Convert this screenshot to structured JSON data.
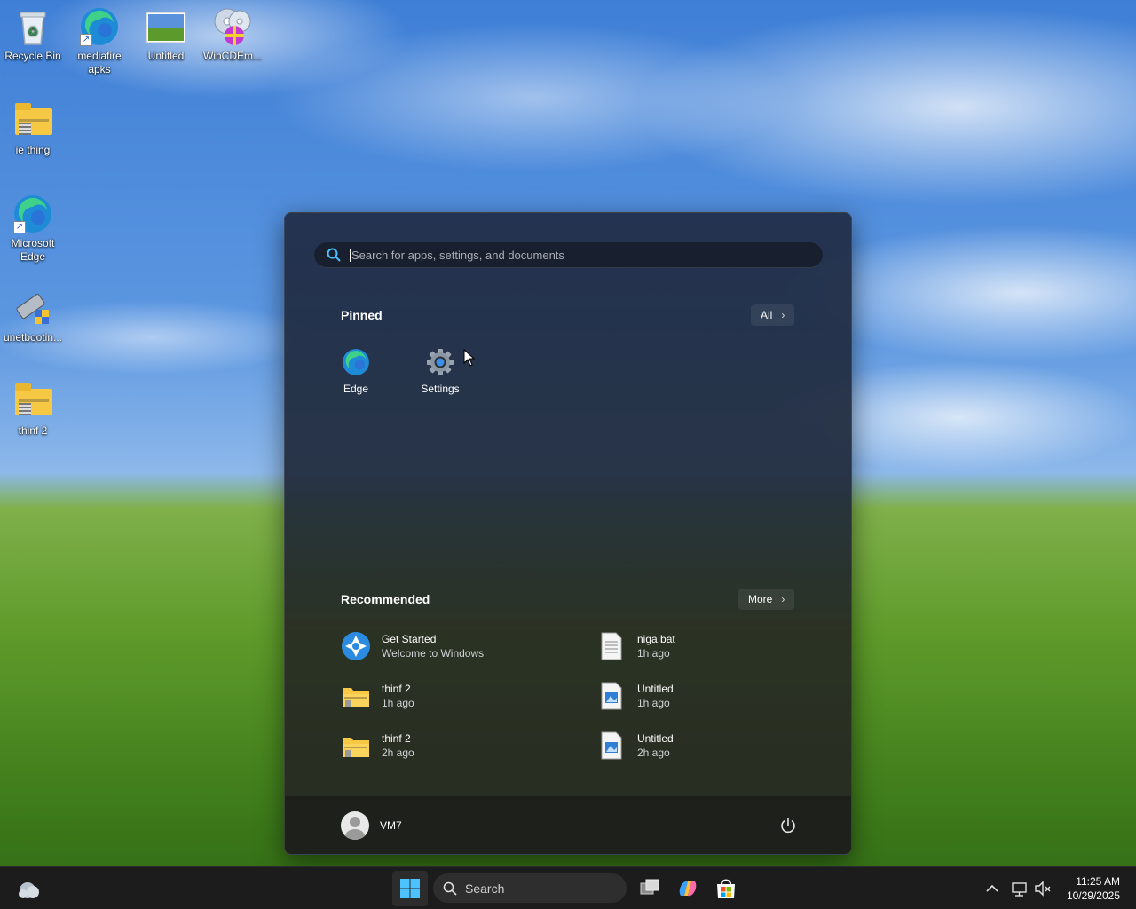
{
  "desktop": {
    "icons": [
      {
        "label": "Recycle Bin",
        "icon": "recycle-bin-icon"
      },
      {
        "label": "mediafire apks",
        "icon": "edge-shortcut-icon"
      },
      {
        "label": "Untitled",
        "icon": "image-file-icon"
      },
      {
        "label": "WinCDEm...",
        "icon": "disc-app-icon"
      },
      {
        "label": "ie thing",
        "icon": "zip-folder-icon"
      },
      {
        "label": "Microsoft Edge",
        "icon": "edge-icon"
      },
      {
        "label": "unetbootin...",
        "icon": "unetbootin-icon"
      },
      {
        "label": "thinf 2",
        "icon": "zip-folder-icon"
      }
    ]
  },
  "start_menu": {
    "search_placeholder": "Search for apps, settings, and documents",
    "pinned_title": "Pinned",
    "all_label": "All",
    "pinned_apps": [
      {
        "label": "Edge",
        "icon": "edge-icon"
      },
      {
        "label": "Settings",
        "icon": "gear-icon"
      }
    ],
    "recommended_title": "Recommended",
    "more_label": "More",
    "recommended": [
      {
        "title": "Get Started",
        "subtitle": "Welcome to Windows",
        "icon": "get-started-icon"
      },
      {
        "title": "niga.bat",
        "subtitle": "1h ago",
        "icon": "text-file-icon"
      },
      {
        "title": "thinf 2",
        "subtitle": "1h ago",
        "icon": "zip-folder-icon"
      },
      {
        "title": "Untitled",
        "subtitle": "1h ago",
        "icon": "image-file-icon"
      },
      {
        "title": "thinf 2",
        "subtitle": "2h ago",
        "icon": "zip-folder-icon"
      },
      {
        "title": "Untitled",
        "subtitle": "2h ago",
        "icon": "image-file-icon"
      }
    ],
    "user_name": "VM7"
  },
  "taskbar": {
    "search_label": "Search",
    "time": "11:25 AM",
    "date": "10/29/2025"
  },
  "colors": {
    "accent": "#4cc2ff",
    "taskbar_bg": "#1c1c1c"
  }
}
